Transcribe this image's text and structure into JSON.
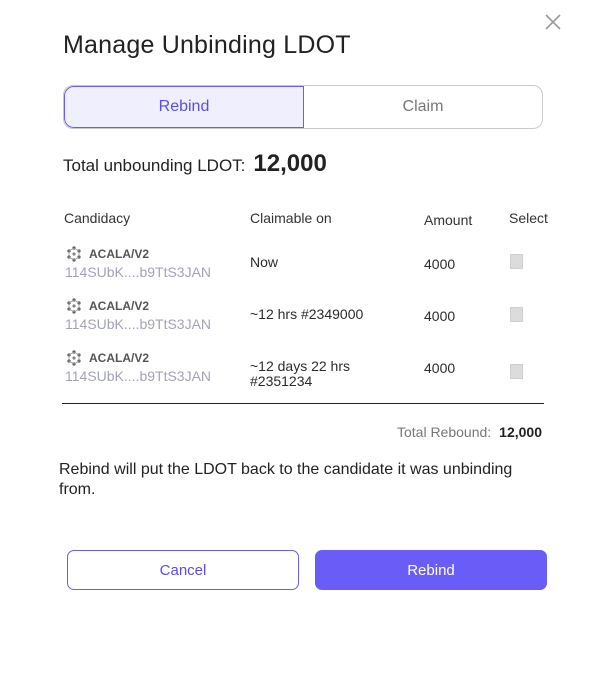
{
  "dialog": {
    "title": "Manage Unbinding LDOT",
    "close_icon": "close-icon"
  },
  "tabs": [
    {
      "label": "Rebind",
      "active": true
    },
    {
      "label": "Claim",
      "active": false
    }
  ],
  "total": {
    "label": "Total unbounding LDOT:",
    "value": "12,000"
  },
  "table": {
    "headers": {
      "candidacy": "Candidacy",
      "claimable": "Claimable on",
      "amount": "Amount",
      "select": "Select"
    },
    "rows": [
      {
        "name": "ACALA/V2",
        "address": "114SUbK....b9TtS3JAN",
        "claimable": "Now",
        "claimable_line2": "",
        "amount": "4000",
        "icon": "candidate-logo-icon",
        "selected": false
      },
      {
        "name": "ACALA/V2",
        "address": "114SUbK....b9TtS3JAN",
        "claimable": "~12 hrs #2349000",
        "claimable_line2": "",
        "amount": "4000",
        "icon": "candidate-logo-icon",
        "selected": false
      },
      {
        "name": "ACALA/V2",
        "address": "114SUbK....b9TtS3JAN",
        "claimable": "~12 days 22 hrs",
        "claimable_line2": "#2351234",
        "amount": "4000",
        "icon": "candidate-logo-icon",
        "selected": false
      }
    ]
  },
  "rebound": {
    "label": "Total Rebound:",
    "value": "12,000"
  },
  "info_text": "Rebind will put the LDOT back to the candidate it was unbinding from.",
  "buttons": {
    "cancel": "Cancel",
    "rebind": "Rebind"
  },
  "colors": {
    "accent": "#6a5cf6",
    "accent_text": "#5b4cf0",
    "tab_active_bg": "#efeffe",
    "address": "#a3a3b8"
  }
}
